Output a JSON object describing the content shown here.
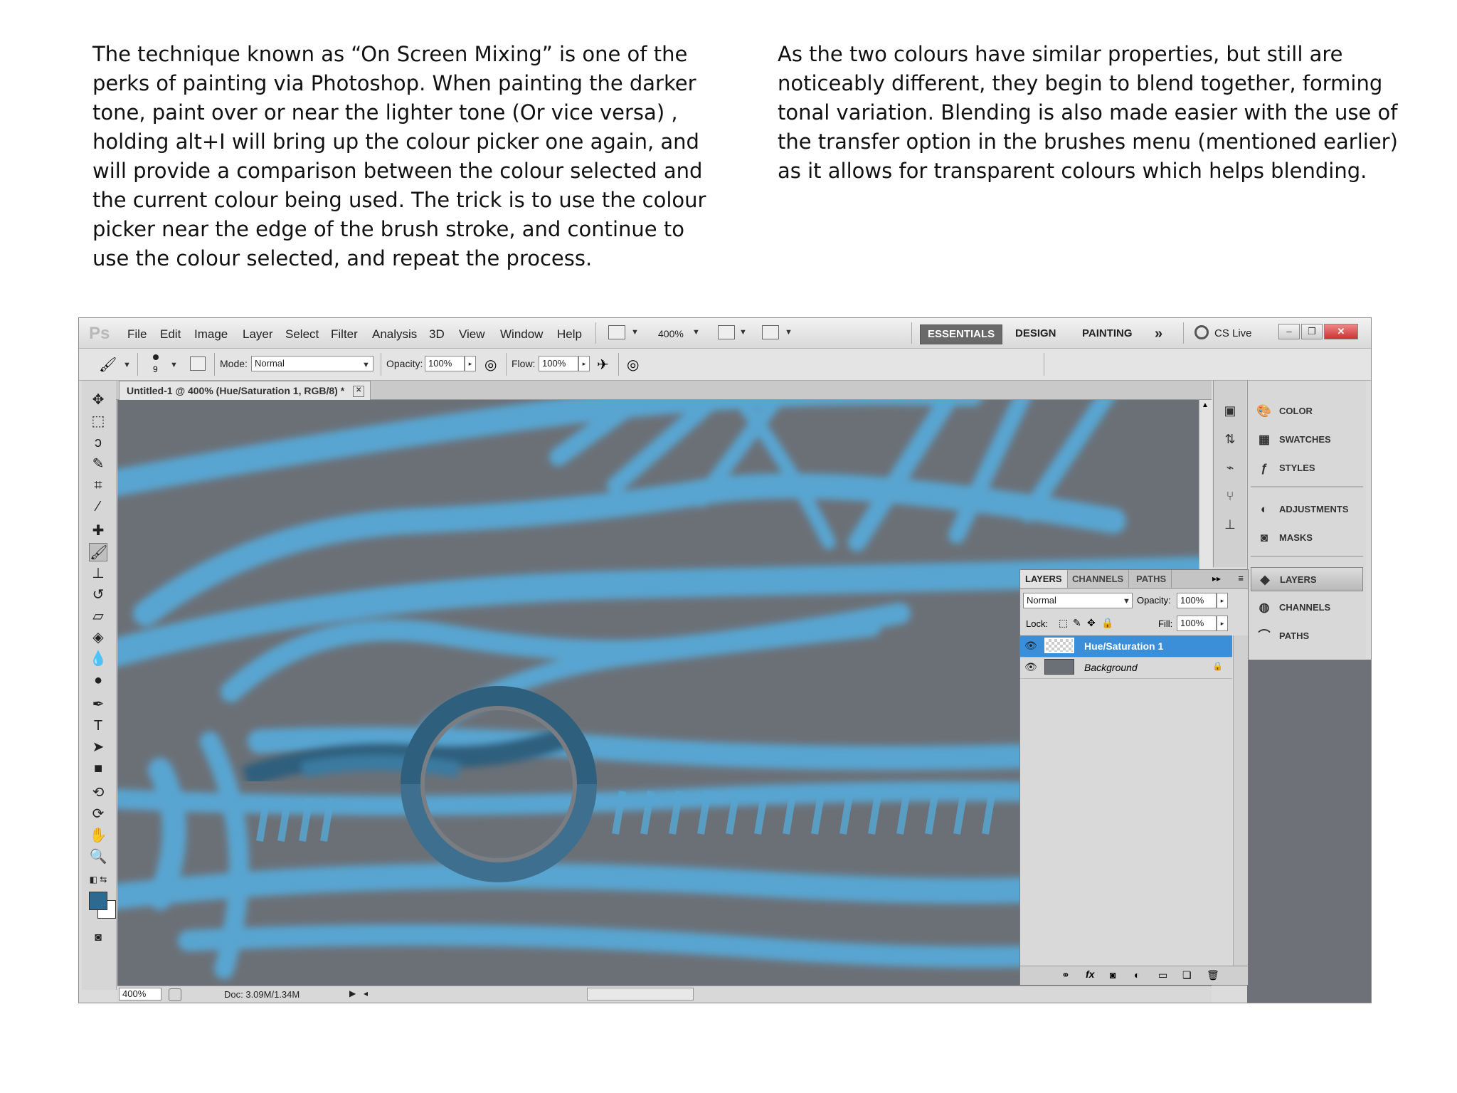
{
  "text": {
    "left_paragraph": "The technique known as “On Screen Mixing” is one of the perks of painting via Photoshop. When painting the darker tone, paint over or near the lighter tone (Or vice versa) , holding alt+I will bring up the colour picker one again, and will provide a comparison between the colour selected and the current colour being used. The trick is to use the colour picker near the edge of the brush stroke, and continue to use the colour selected, and repeat the process.",
    "right_paragraph": "As the two colours have similar properties, but still are noticeably different, they begin to blend together, forming tonal variation. Blending is also made easier with the use of the transfer option in the brushes menu (mentioned earlier) as it allows for transparent colours which helps blending."
  },
  "app": {
    "logo": "Ps",
    "menu": [
      "File",
      "Edit",
      "Image",
      "Layer",
      "Select",
      "Filter",
      "Analysis",
      "3D",
      "View",
      "Window",
      "Help"
    ],
    "zoom_menu": "400%",
    "workspaces": [
      "ESSENTIALS",
      "DESIGN",
      "PAINTING"
    ],
    "more_workspaces": "»",
    "cs_live": "CS Live"
  },
  "options": {
    "brush_size": "9",
    "mode_label": "Mode:",
    "mode_value": "Normal",
    "opacity_label": "Opacity:",
    "opacity_value": "100%",
    "flow_label": "Flow:",
    "flow_value": "100%"
  },
  "document": {
    "tab_title": "Untitled-1 @ 400% (Hue/Saturation 1, RGB/8) *",
    "zoom_status": "400%",
    "doc_size": "Doc: 3.09M/1.34M"
  },
  "right_panel": {
    "items": [
      "COLOR",
      "SWATCHES",
      "STYLES",
      "ADJUSTMENTS",
      "MASKS",
      "LAYERS",
      "CHANNELS",
      "PATHS"
    ]
  },
  "layers_panel": {
    "tabs": [
      "LAYERS",
      "CHANNELS",
      "PATHS"
    ],
    "blend_mode": "Normal",
    "opacity_label": "Opacity:",
    "opacity_value": "100%",
    "lock_label": "Lock:",
    "fill_label": "Fill:",
    "fill_value": "100%",
    "layers": [
      "Hue/Saturation 1",
      "Background"
    ]
  },
  "colors": {
    "stroke_blue": "#58a5d1",
    "dark_blue": "#2e5f7d",
    "canvas_gray": "#6b7077",
    "selected_layer": "#3b8fd8"
  }
}
